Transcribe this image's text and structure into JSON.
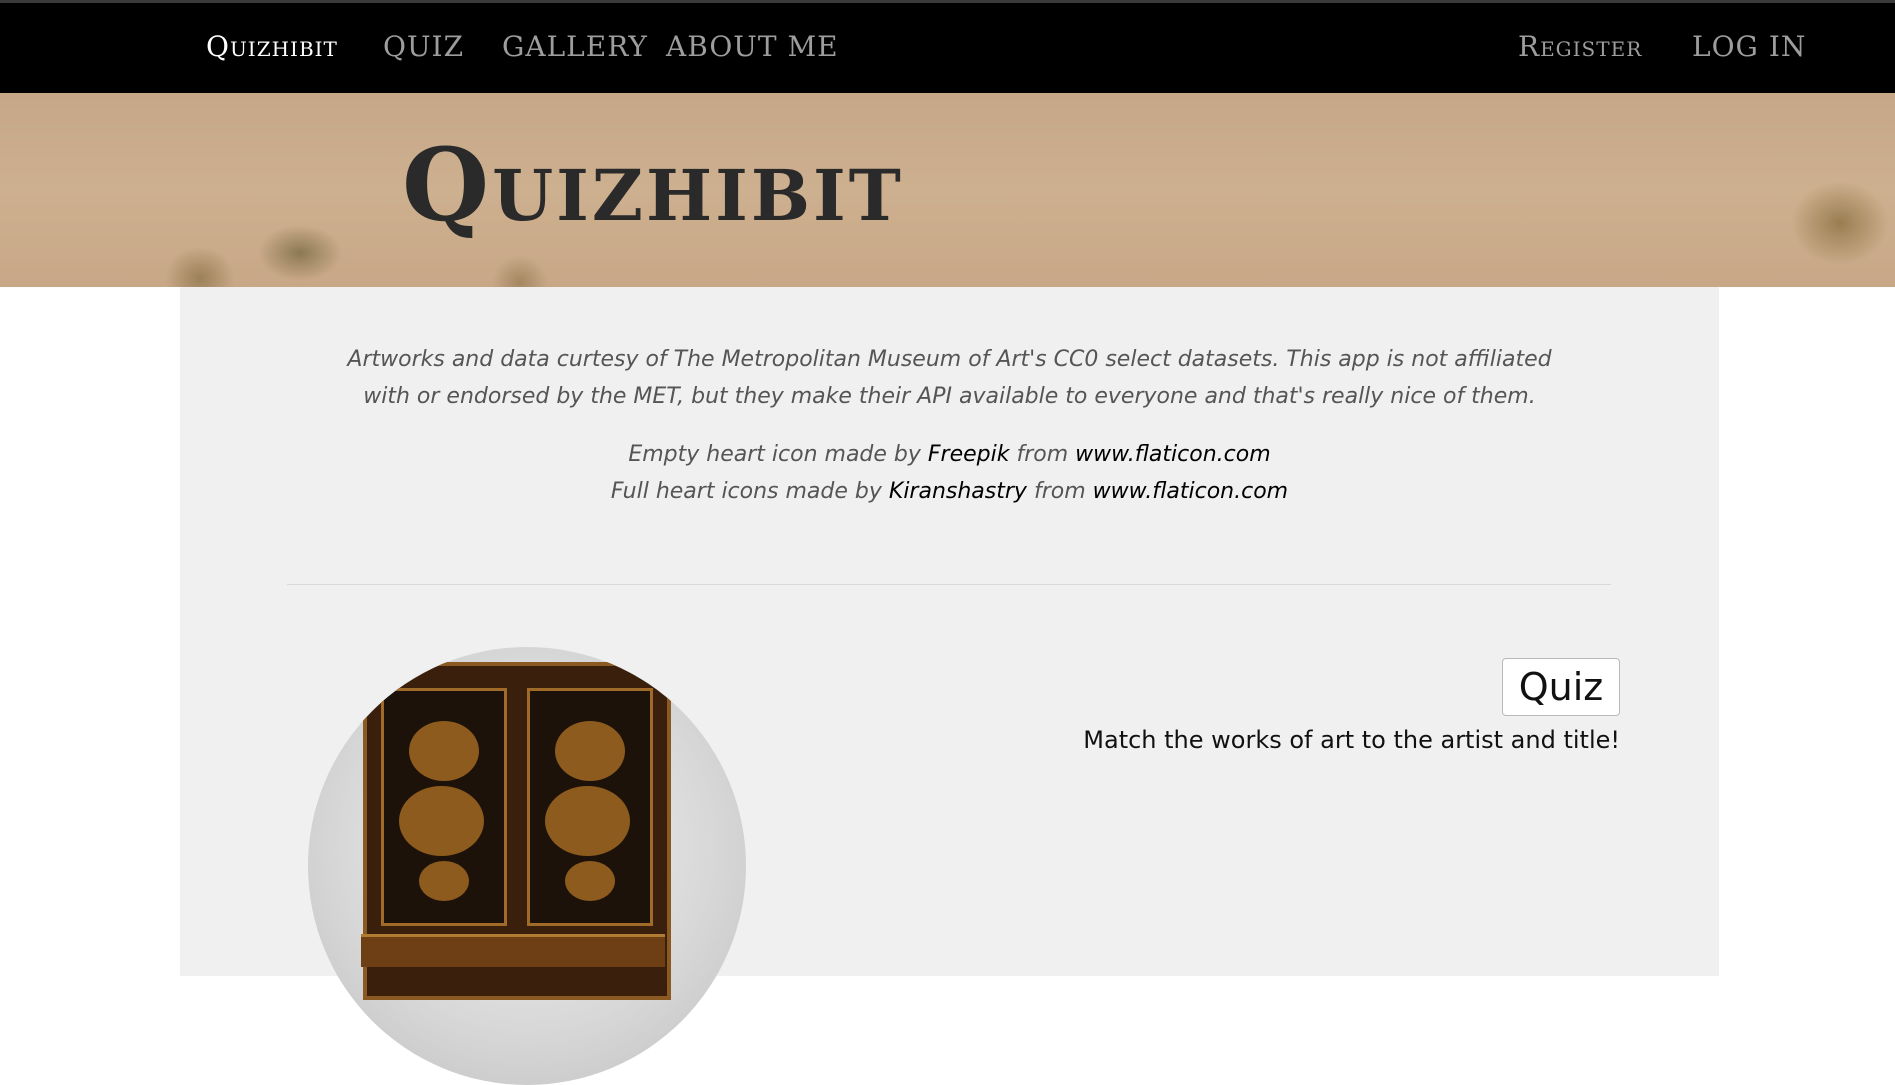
{
  "navbar": {
    "brand": "Quizhibit",
    "links": [
      "QUIZ",
      "GALLERY",
      "ABOUT ME"
    ],
    "right_links": [
      "Register",
      "LOG IN"
    ]
  },
  "hero": {
    "title": "Quizhibit"
  },
  "credits": {
    "line1": "Artworks and data curtesy of The Metropolitan Museum of Art's CC0 select datasets. This app is not affiliated with or endorsed by the MET, but they make their API available to everyone and that's really nice of them.",
    "empty_heart_prefix": "Empty heart icon made by ",
    "empty_heart_author": "Freepik",
    "from_word": " from ",
    "site": "www.flaticon.com",
    "full_heart_prefix": "Full heart icons made by ",
    "full_heart_author": "Kiranshastry"
  },
  "feature": {
    "button_label": "Quiz",
    "description": "Match the works of art to the artist and title!"
  },
  "colors": {
    "navbar_bg": "#000000",
    "nav_link": "#9d9d9d",
    "panel_bg": "#f0f0f0"
  }
}
